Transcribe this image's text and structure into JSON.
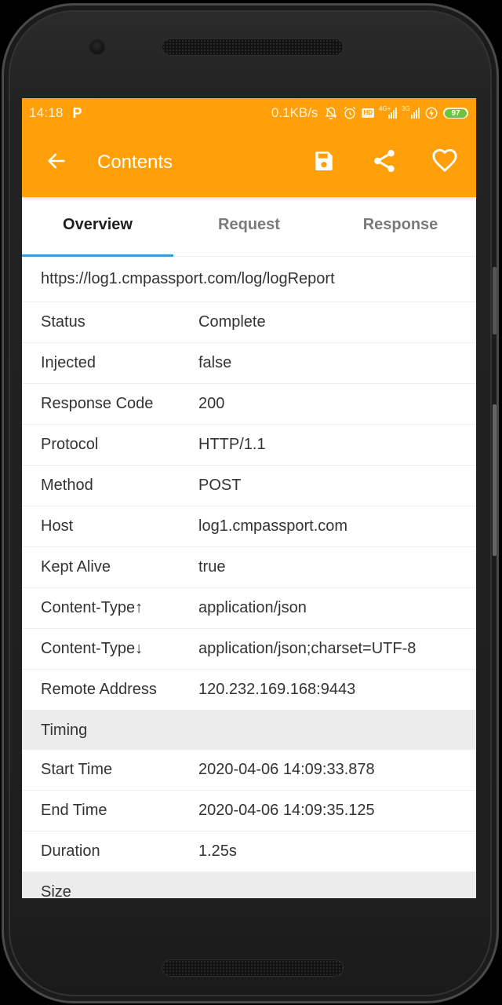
{
  "status_bar": {
    "time": "14:18",
    "app_indicator": "P",
    "net_speed": "0.1KB/s",
    "icons": [
      "notifications-off-icon",
      "alarm-icon",
      "hd-icon",
      "signal-4g-icon",
      "signal-3g-icon",
      "charging-icon"
    ],
    "hd_label": "HD",
    "sig1_label": "4G+",
    "sig2_label": "3G",
    "battery_level": "97"
  },
  "toolbar": {
    "title": "Contents",
    "back_icon": "arrow-back-icon",
    "actions": [
      "save-icon",
      "share-icon",
      "favorite-icon"
    ]
  },
  "tabs": [
    {
      "label": "Overview",
      "active": true
    },
    {
      "label": "Request",
      "active": false
    },
    {
      "label": "Response",
      "active": false
    }
  ],
  "overview": {
    "url": "https://log1.cmpassport.com/log/logReport",
    "rows": [
      {
        "key": "Status",
        "value": "Complete"
      },
      {
        "key": "Injected",
        "value": "false"
      },
      {
        "key": "Response Code",
        "value": "200"
      },
      {
        "key": "Protocol",
        "value": "HTTP/1.1"
      },
      {
        "key": "Method",
        "value": "POST"
      },
      {
        "key": "Host",
        "value": "log1.cmpassport.com"
      },
      {
        "key": "Kept Alive",
        "value": "true"
      },
      {
        "key": "Content-Type↑",
        "value": "application/json"
      },
      {
        "key": "Content-Type↓",
        "value": "application/json;charset=UTF-8"
      },
      {
        "key": "Remote Address",
        "value": "120.232.169.168:9443"
      }
    ],
    "timing_section": "Timing",
    "timing_rows": [
      {
        "key": "Start Time",
        "value": "2020-04-06 14:09:33.878"
      },
      {
        "key": "End Time",
        "value": "2020-04-06 14:09:35.125"
      },
      {
        "key": "Duration",
        "value": "1.25s"
      }
    ],
    "size_section": "Size"
  },
  "colors": {
    "accent": "#ff9f0a",
    "tab_indicator": "#3d9bd7",
    "section_bg": "#ececec",
    "battery_fill": "#6cc43a"
  }
}
